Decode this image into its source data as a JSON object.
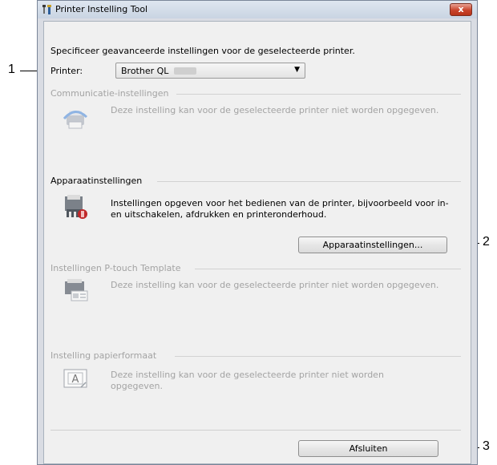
{
  "callouts": [
    "1",
    "2",
    "3"
  ],
  "window": {
    "title": "Printer Instelling Tool",
    "close_label": "x"
  },
  "intro": "Specificeer geavanceerde instellingen voor de geselecteerde printer.",
  "printer": {
    "label": "Printer:",
    "selected": "Brother QL"
  },
  "groups": {
    "communication": {
      "title": "Communicatie-instellingen",
      "text": "Deze instelling kan voor de geselecteerde printer niet worden opgegeven.",
      "icon": "printer-communication-icon"
    },
    "device": {
      "title": "Apparaatinstellingen",
      "text_line1": "Instellingen opgeven voor het bedienen van de printer, bijvoorbeeld voor in-",
      "text_line2": "en uitschakelen, afdrukken en printeronderhoud.",
      "button_label": "Apparaatinstellingen...",
      "icon": "device-settings-icon"
    },
    "ptouch": {
      "title": "Instellingen P-touch Template",
      "text": "Deze instelling kan voor de geselecteerde printer niet worden opgegeven.",
      "icon": "ptouch-template-icon"
    },
    "paper": {
      "title": "Instelling papierformaat",
      "text_line1": "Deze instelling kan voor de geselecteerde printer niet worden",
      "text_line2": "opgegeven.",
      "icon": "paper-format-icon"
    }
  },
  "close_button_label": "Afsluiten"
}
